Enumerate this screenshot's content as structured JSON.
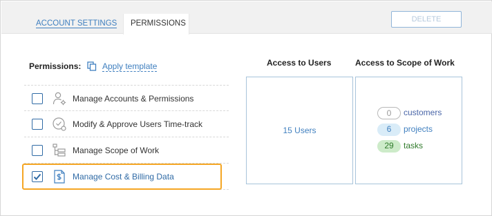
{
  "tabs": {
    "account_settings": "ACCOUNT SETTINGS",
    "permissions": "PERMISSIONS"
  },
  "toolbar": {
    "delete_label": "DELETE"
  },
  "permissions": {
    "label": "Permissions:",
    "apply_template": "Apply template",
    "items": [
      {
        "label": "Manage Accounts & Permissions",
        "checked": false,
        "icon": "user-gear-icon"
      },
      {
        "label": "Modify & Approve Users Time-track",
        "checked": false,
        "icon": "clock-check-icon"
      },
      {
        "label": "Manage Scope of Work",
        "checked": false,
        "icon": "tree-icon"
      },
      {
        "label": "Manage Cost & Billing Data",
        "checked": true,
        "icon": "dollar-document-icon"
      }
    ]
  },
  "access_users": {
    "header": "Access to Users",
    "value": "15 Users"
  },
  "access_scope": {
    "header": "Access to Scope of Work",
    "items": [
      {
        "count": "0",
        "label": "customers"
      },
      {
        "count": "6",
        "label": "projects"
      },
      {
        "count": "29",
        "label": "tasks"
      }
    ]
  },
  "colors": {
    "accent": "#3f7fbf",
    "highlight": "#f5a623",
    "tasks_green": "#2f7a2a"
  }
}
